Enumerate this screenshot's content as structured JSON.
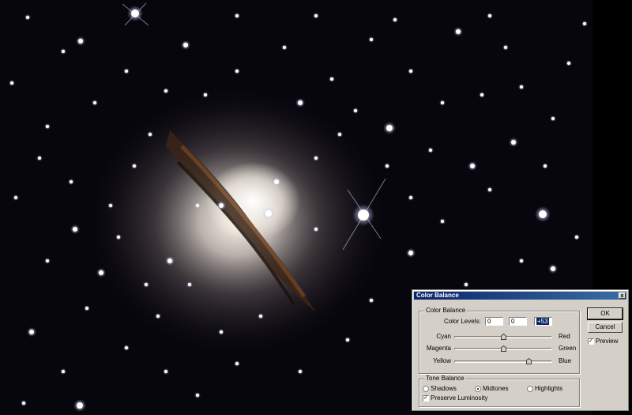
{
  "dialog": {
    "title": "Color Balance",
    "close_glyph": "x",
    "color_balance_group": {
      "title": "Color Balance",
      "levels_label": "Color Levels:",
      "levels": [
        "0",
        "0",
        "+53"
      ],
      "sliders": [
        {
          "left": "Cyan",
          "right": "Red",
          "value": 0
        },
        {
          "left": "Magenta",
          "right": "Green",
          "value": 0
        },
        {
          "left": "Yellow",
          "right": "Blue",
          "value": 53
        }
      ],
      "slider_range": [
        -100,
        100
      ]
    },
    "tone_balance_group": {
      "title": "Tone Balance",
      "options": [
        "Shadows",
        "Midtones",
        "Highlights"
      ],
      "selected": "Midtones",
      "preserve_luminosity_label": "Preserve Luminosity",
      "preserve_luminosity": true
    },
    "ok_label": "OK",
    "cancel_label": "Cancel",
    "preview_label": "Preview",
    "preview_checked": true
  },
  "image": {
    "subject": "galaxy-starfield",
    "background_color": "#07060c"
  },
  "colors": {
    "dialog_face": "#d4d0c8",
    "titlebar": "#0a246a",
    "selection": "#0a246a"
  }
}
